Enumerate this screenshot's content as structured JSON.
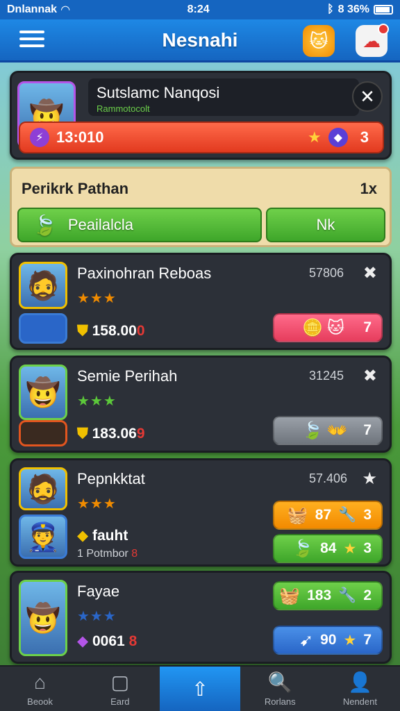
{
  "status": {
    "carrier": "Dnlannak",
    "time": "8:24",
    "battery": "8 36%"
  },
  "header": {
    "title": "Nesnahi"
  },
  "top": {
    "name": "Sutslamc Nanqosi",
    "sub": "Rammotocolt",
    "value": "13:010",
    "count": "3"
  },
  "banner": {
    "title": "Perikrk Pathan",
    "close": "1x",
    "btn_left": "Peailalcla",
    "btn_right": "Nk"
  },
  "rows": [
    {
      "name": "Paxinohran Reboas",
      "num": "57806",
      "stars": "★★★",
      "money": "158.00",
      "money_suffix": "0",
      "pill": "7",
      "pill_color": "pink"
    },
    {
      "name": "Semie Perihah",
      "num": "31245",
      "stars": "★★★",
      "money": "183.06",
      "money_suffix": "9",
      "pill": "7",
      "pill_color": "grey"
    },
    {
      "name": "Pepnkktat",
      "num": "57.406",
      "stars": "★★★",
      "money": "fauht",
      "sub": "Potmbor",
      "sub_suffix": "8",
      "pill1_val": "87",
      "pill1": "3",
      "pill2_val": "84",
      "pill2": "3"
    },
    {
      "name": "Fayae",
      "stars": "★★★",
      "money": "0061",
      "money_suffix": "8",
      "pill1_val": "183",
      "pill1": "2",
      "pill2_val": "90",
      "pill2": "7"
    }
  ],
  "nav": [
    {
      "label": "Beook",
      "icon": "home-icon"
    },
    {
      "label": "Eard",
      "icon": "cards-icon"
    },
    {
      "label": "",
      "icon": "share-icon"
    },
    {
      "label": "Rorlans",
      "icon": "search-icon"
    },
    {
      "label": "Nendent",
      "icon": "user-icon"
    }
  ],
  "colors": {
    "header": "#1565c0",
    "panel": "#2c3038",
    "green": "#3ea62a",
    "red": "#e23a1f"
  }
}
